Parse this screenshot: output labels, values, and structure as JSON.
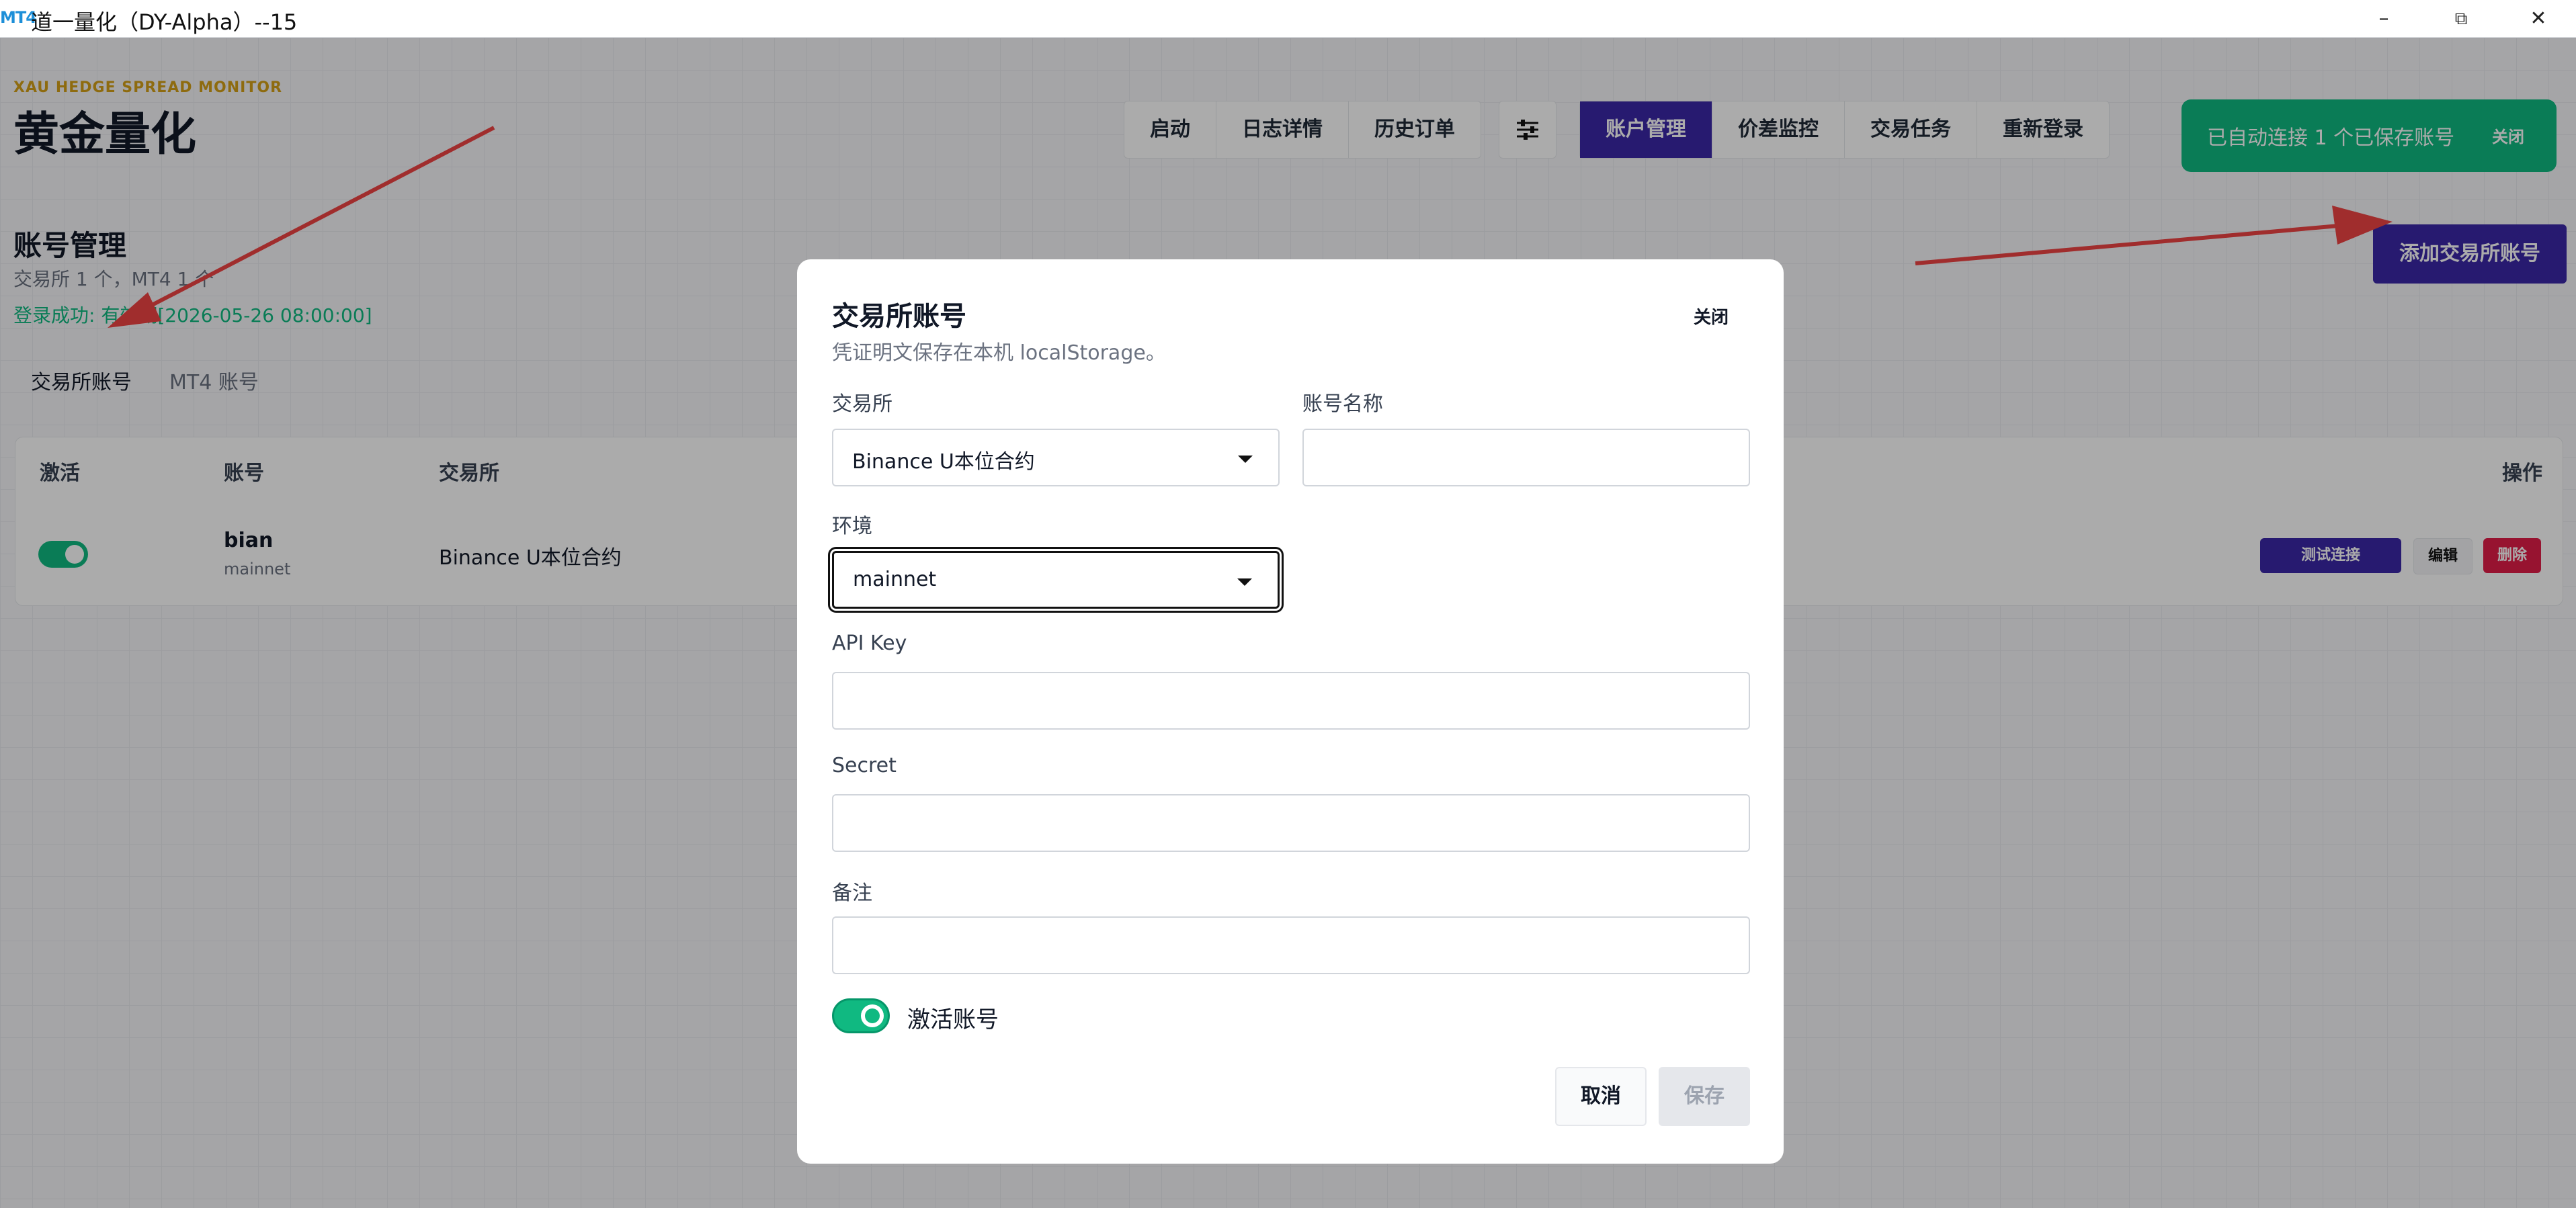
{
  "window": {
    "app_icon_text": "MT4",
    "title": "道一量化（DY-Alpha）--15",
    "controls": {
      "minimize": "–",
      "restore": "⧉",
      "close": "✕"
    }
  },
  "header": {
    "subtitle": "XAU HEDGE SPREAD MONITOR",
    "brand": "黄金量化",
    "nav_left": [
      "启动",
      "日志详情",
      "历史订单"
    ],
    "nav_right": [
      "账户管理",
      "价差监控",
      "交易任务",
      "重新登录"
    ],
    "active_nav": "账户管理"
  },
  "toast": {
    "message": "已自动连接 1 个已保存账号",
    "close_label": "关闭"
  },
  "page": {
    "title": "账号管理",
    "summary": "交易所 1 个，MT4 1 个",
    "login_status": "登录成功: 有效期[2026-05-26 08:00:00]",
    "tabs": [
      "交易所账号",
      "MT4 账号"
    ],
    "active_tab": "交易所账号",
    "add_button": "添加交易所账号"
  },
  "table": {
    "headers": {
      "active": "激活",
      "account": "账号",
      "exchange": "交易所",
      "actions": "操作"
    },
    "rows": [
      {
        "active": true,
        "account": "bian",
        "env": "mainnet",
        "exchange": "Binance U本位合约",
        "actions": {
          "test": "测试连接",
          "edit": "编辑",
          "delete": "删除"
        }
      }
    ]
  },
  "modal": {
    "title": "交易所账号",
    "description": "凭证明文保存在本机 localStorage。",
    "close_label": "关闭",
    "fields": {
      "exchange": {
        "label": "交易所",
        "value": "Binance U本位合约"
      },
      "account_name": {
        "label": "账号名称",
        "value": ""
      },
      "environment": {
        "label": "环境",
        "value": "mainnet"
      },
      "api_key": {
        "label": "API Key",
        "value": ""
      },
      "secret": {
        "label": "Secret",
        "value": ""
      },
      "note": {
        "label": "备注",
        "value": ""
      }
    },
    "activate_label": "激活账号",
    "activate_on": true,
    "cancel_label": "取消",
    "save_label": "保存"
  },
  "colors": {
    "primary": "#3b28a7",
    "success": "#10b981",
    "brand_subtitle": "#d4a017",
    "annotation_arrow": "#ef4444"
  }
}
